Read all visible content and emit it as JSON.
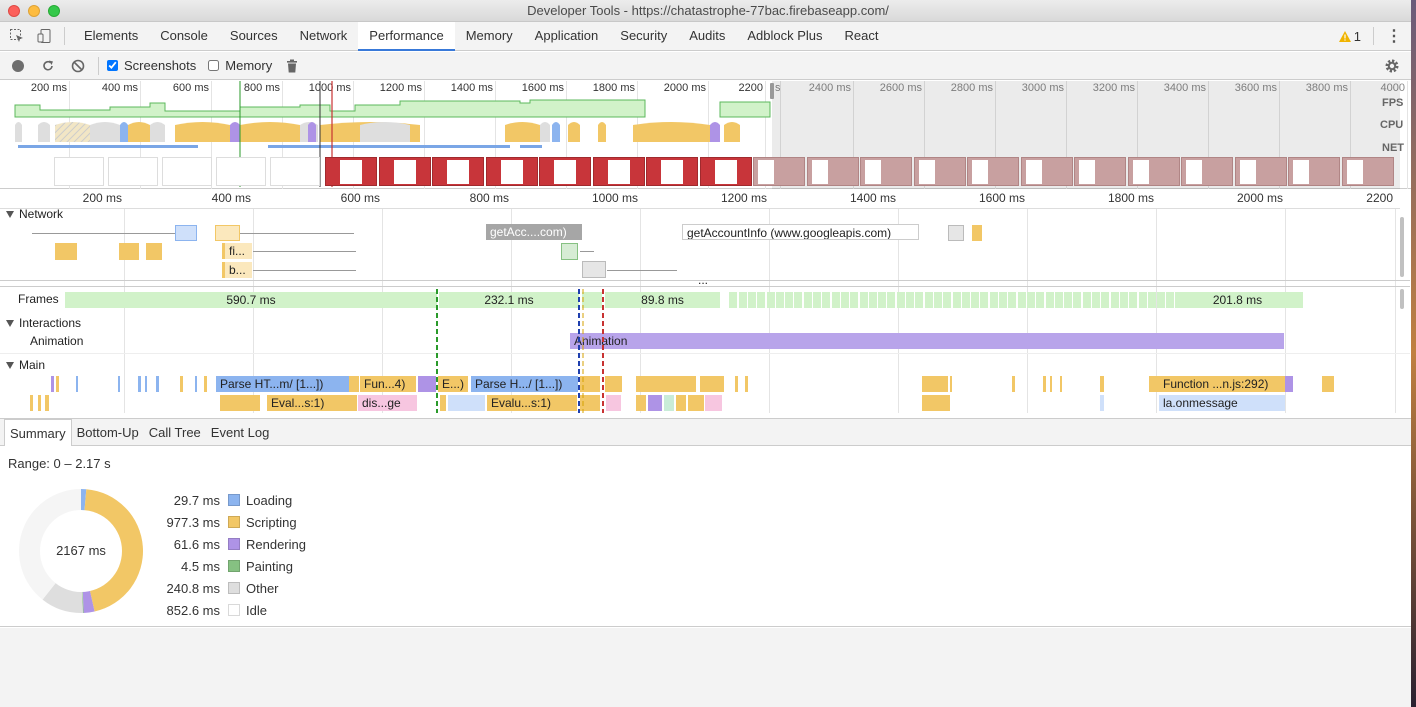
{
  "window": {
    "title": "Developer Tools - https://chatastrophe-77bac.firebaseapp.com/"
  },
  "tabs": [
    "Elements",
    "Console",
    "Sources",
    "Network",
    "Performance",
    "Memory",
    "Application",
    "Security",
    "Audits",
    "Adblock Plus",
    "React"
  ],
  "active_tab": "Performance",
  "warnings": {
    "count": "1"
  },
  "toolbar": {
    "screenshots_label": "Screenshots",
    "screenshots_checked": true,
    "memory_label": "Memory",
    "memory_checked": false
  },
  "overview": {
    "ticks": [
      "200 ms",
      "400 ms",
      "600 ms",
      "800 ms",
      "1000 ms",
      "1200 ms",
      "1400 ms",
      "1600 ms",
      "1800 ms",
      "2000 ms",
      "2200",
      "s",
      "2400 ms",
      "2600 ms",
      "2800 ms",
      "3000 ms",
      "3200 ms",
      "3400 ms",
      "3600 ms",
      "3800 ms",
      "4000"
    ],
    "labels": {
      "fps": "FPS",
      "cpu": "CPU",
      "net": "NET"
    }
  },
  "timeline": {
    "ticks": [
      "200 ms",
      "400 ms",
      "600 ms",
      "800 ms",
      "1000 ms",
      "1200 ms",
      "1400 ms",
      "1600 ms",
      "1800 ms",
      "2000 ms",
      "2200"
    ],
    "network_label": "Network",
    "requests": [
      "getAcc....com)",
      "getAccountInfo (www.googleapis.com)",
      "fi...",
      "b..."
    ],
    "more": "...",
    "frames_label": "Frames",
    "frames": [
      "590.7 ms",
      "232.1 ms",
      "89.8 ms",
      "201.8 ms"
    ],
    "interactions_label": "Interactions",
    "animation_label": "Animation",
    "animation_bar": "Animation",
    "main_label": "Main",
    "main_row1": [
      "Parse HT...m/ [1...])",
      "Fun...4)",
      "E...)",
      "Parse H.../ [1...])",
      "Function ...n.js:292)"
    ],
    "main_row2": [
      "Eval...s:1)",
      "dis...ge",
      "Evalu...s:1)",
      "la.onmessage"
    ]
  },
  "bottom_tabs": [
    "Summary",
    "Bottom-Up",
    "Call Tree",
    "Event Log"
  ],
  "active_bottom_tab": "Summary",
  "summary": {
    "range": "Range: 0 – 2.17 s",
    "total": "2167 ms",
    "items": [
      {
        "value": "29.7 ms",
        "label": "Loading",
        "color": "#8cb4ef"
      },
      {
        "value": "977.3 ms",
        "label": "Scripting",
        "color": "#f2c766"
      },
      {
        "value": "61.6 ms",
        "label": "Rendering",
        "color": "#ae93e6"
      },
      {
        "value": "4.5 ms",
        "label": "Painting",
        "color": "#86c182"
      },
      {
        "value": "240.8 ms",
        "label": "Other",
        "color": "#dedede"
      },
      {
        "value": "852.6 ms",
        "label": "Idle",
        "color": "#ffffff"
      }
    ]
  },
  "colors": {
    "scripting": "#f2c766",
    "rendering": "#ae93e6",
    "loading": "#8cb4ef",
    "painting": "#86c182",
    "accent": "#3879d9"
  }
}
